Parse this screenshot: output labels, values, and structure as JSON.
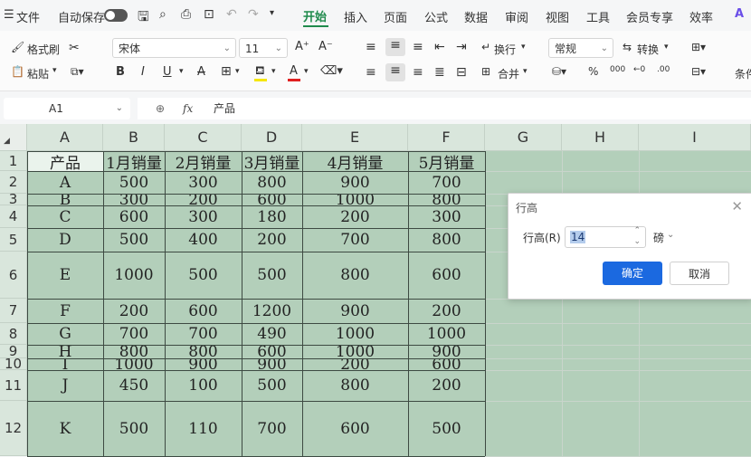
{
  "menubar": {
    "file": "文件",
    "autosave": "自动保存",
    "tabs": [
      "开始",
      "插入",
      "页面",
      "公式",
      "数据",
      "审阅",
      "视图",
      "工具",
      "会员专享",
      "效率"
    ],
    "active_tab": "开始",
    "accent": "#1f8a4c"
  },
  "ribbon": {
    "format_painter": "格式刷",
    "paste": "粘贴",
    "font_name": "宋体",
    "font_size": "11",
    "wrap": "换行",
    "merge": "合并",
    "number_format": "常规",
    "convert": "转换",
    "condition": "条件",
    "font_color": "#e02020",
    "fill_color": "#f5e60a"
  },
  "formula": {
    "name_box": "A1",
    "fx": "fx",
    "content": "产品"
  },
  "sheet": {
    "columns": [
      "A",
      "B",
      "C",
      "D",
      "E",
      "F",
      "G",
      "H",
      "I"
    ],
    "rows": [
      "1",
      "2",
      "3",
      "4",
      "5",
      "6",
      "7",
      "8",
      "9",
      "10",
      "11",
      "12"
    ],
    "header": [
      "产品",
      "1月销量",
      "2月销量",
      "3月销量",
      "4月销量",
      "5月销量"
    ],
    "data": [
      [
        "A",
        "500",
        "300",
        "800",
        "900",
        "700"
      ],
      [
        "B",
        "300",
        "200",
        "600",
        "1000",
        "800"
      ],
      [
        "C",
        "600",
        "300",
        "180",
        "200",
        "300"
      ],
      [
        "D",
        "500",
        "400",
        "200",
        "700",
        "800"
      ],
      [
        "E",
        "1000",
        "500",
        "500",
        "800",
        "600"
      ],
      [
        "F",
        "200",
        "600",
        "1200",
        "900",
        "200"
      ],
      [
        "G",
        "700",
        "700",
        "490",
        "1000",
        "1000"
      ],
      [
        "H",
        "800",
        "800",
        "600",
        "1000",
        "900"
      ],
      [
        "I",
        "1000",
        "900",
        "900",
        "200",
        "600"
      ],
      [
        "J",
        "450",
        "100",
        "500",
        "800",
        "200"
      ],
      [
        "K",
        "500",
        "110",
        "700",
        "600",
        "500"
      ]
    ]
  },
  "dialog": {
    "title": "行高",
    "label": "行高(R)",
    "value": "14",
    "unit": "磅",
    "ok": "确定",
    "cancel": "取消"
  }
}
